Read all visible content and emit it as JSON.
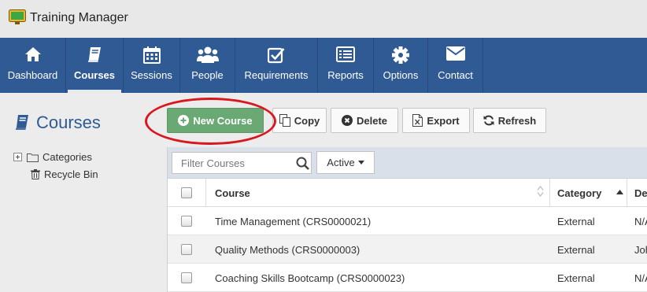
{
  "app": {
    "title": "Training Manager"
  },
  "nav": {
    "items": [
      {
        "label": "Dashboard",
        "icon": "home-icon"
      },
      {
        "label": "Courses",
        "icon": "book-icon",
        "active": true
      },
      {
        "label": "Sessions",
        "icon": "calendar-icon"
      },
      {
        "label": "People",
        "icon": "people-icon"
      },
      {
        "label": "Requirements",
        "icon": "checkbox-icon"
      },
      {
        "label": "Reports",
        "icon": "report-icon"
      },
      {
        "label": "Options",
        "icon": "gear-icon"
      },
      {
        "label": "Contact",
        "icon": "envelope-icon"
      }
    ]
  },
  "page": {
    "title": "Courses"
  },
  "sidebar": {
    "categories": "Categories",
    "recycle_bin": "Recycle Bin"
  },
  "toolbar": {
    "new_course": "New Course",
    "copy": "Copy",
    "delete": "Delete",
    "export": "Export",
    "refresh": "Refresh"
  },
  "filter": {
    "placeholder": "Filter Courses",
    "status": "Active"
  },
  "table": {
    "headers": {
      "course": "Course",
      "category": "Category",
      "description": "De"
    },
    "rows": [
      {
        "course": "Time Management (CRS0000021)",
        "category": "External",
        "description": "N/A"
      },
      {
        "course": "Quality Methods (CRS0000003)",
        "category": "External",
        "description": "John"
      },
      {
        "course": "Coaching Skills Bootcamp (CRS0000023)",
        "category": "External",
        "description": "N/A"
      }
    ]
  },
  "colors": {
    "nav_bg": "#2f5a94",
    "primary_button": "#6aa874",
    "highlight": "#d9171e",
    "title_blue": "#2f5a94"
  }
}
